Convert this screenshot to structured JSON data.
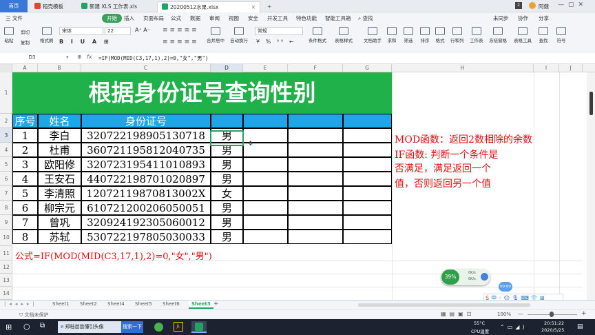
{
  "titlebar": {
    "home": "首页",
    "tabs": [
      "稻壳模板",
      "新建 XLS 工作表.xls",
      "20200512水果.xlsx"
    ],
    "user": "阿健"
  },
  "menubar": {
    "file": "三 文件",
    "items": [
      "开始",
      "插入",
      "页面布局",
      "公式",
      "数据",
      "审阅",
      "视图",
      "安全",
      "开发工具",
      "特色功能",
      "智能工具箱"
    ],
    "search": "查找",
    "right": [
      "未同步",
      "协作",
      "分享"
    ]
  },
  "ribbon": {
    "paste": "粘贴",
    "cut": "剪切",
    "copy": "复制",
    "format_painter": "格式刷",
    "font_name": "宋体",
    "font_size": "22",
    "merge": "合并居中",
    "wrap": "自动换行",
    "number_format": "常规",
    "tools": [
      "条件格式",
      "表格样式",
      "文档助手",
      "求和",
      "筛选",
      "排序",
      "格式",
      "行和列",
      "工作表",
      "冻结窗格",
      "表格工具",
      "查找",
      "符号"
    ]
  },
  "formula_bar": {
    "cell_ref": "D3",
    "fx": "fx",
    "formula": "=IF(MOD(MID(C3,17,1),2)=0,\"女\",\"男\")"
  },
  "columns": [
    "A",
    "B",
    "C",
    "D",
    "E",
    "F",
    "G",
    "H",
    "I",
    "J"
  ],
  "rows": [
    "1",
    "2",
    "3",
    "4",
    "5",
    "6",
    "7",
    "8",
    "9",
    "10",
    "11",
    "12",
    "13",
    "14"
  ],
  "sheet": {
    "title": "根据身份证号查询性别",
    "headers": [
      "序号",
      "姓名",
      "身份证号"
    ],
    "records": [
      {
        "no": "1",
        "name": "李白",
        "id": "320722198905130718",
        "gender": "男"
      },
      {
        "no": "2",
        "name": "杜甫",
        "id": "360721195812040735",
        "gender": "男"
      },
      {
        "no": "3",
        "name": "欧阳修",
        "id": "320723195411010893",
        "gender": "男"
      },
      {
        "no": "4",
        "name": "王安石",
        "id": "440722198701020897",
        "gender": "男"
      },
      {
        "no": "5",
        "name": "李清照",
        "id": "12072119870813002X",
        "gender": "女"
      },
      {
        "no": "6",
        "name": "柳宗元",
        "id": "610721200206050051",
        "gender": "男"
      },
      {
        "no": "7",
        "name": "曾巩",
        "id": "320924192305060012",
        "gender": "男"
      },
      {
        "no": "8",
        "name": "苏轼",
        "id": "530722197805030033",
        "gender": "男"
      }
    ],
    "formula_note": "公式=IF(MOD(MID(C3,17,1),2)=0,\"女\",\"男\")",
    "notes": [
      "MOD函数：返回2数相除的余数",
      "IF函数: 判断一个条件是",
      "否满足，满足返回一个",
      "值，否则返回另一个值"
    ]
  },
  "sheet_tabs": [
    "Sheet1",
    "Sheet2",
    "Sheet4",
    "Sheet5",
    "Sheet6",
    "Sheet3"
  ],
  "active_sheet": "Sheet3",
  "status": {
    "protect": "文档未保护",
    "zoom": "100%"
  },
  "widget": {
    "cpu": "39%",
    "up": "0K/s",
    "down": "0K/s",
    "timer": "00:00"
  },
  "taskbar": {
    "app": "郑档苗苗懂引头像",
    "search": "搜索一下",
    "temp": "55°C",
    "temp_label": "CPU温度",
    "time": "20:51:22",
    "date": "2020/5/25"
  },
  "colors": {
    "title_bg": "#21b14b",
    "header_bg": "#1fa6e6",
    "note_red": "#e01010",
    "start_green": "#3ba15d"
  }
}
